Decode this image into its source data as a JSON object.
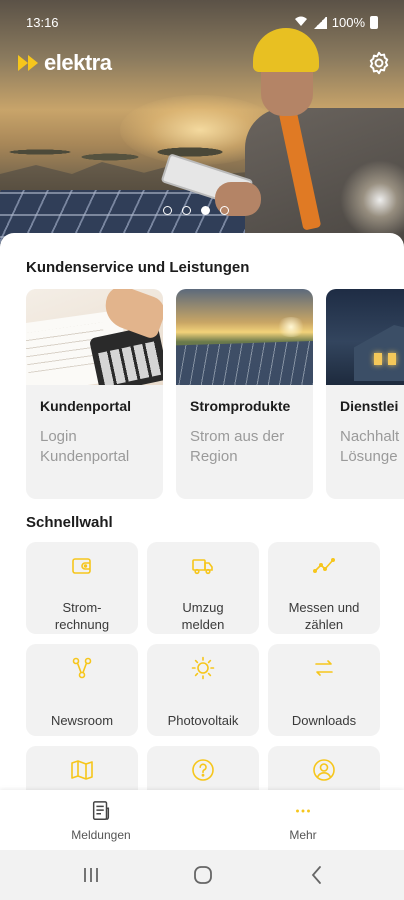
{
  "status_bar": {
    "time": "13:16",
    "battery": "100%"
  },
  "brand": {
    "name": "elektra",
    "accent": "#F6C61C"
  },
  "hero": {
    "carousel_dots": 4,
    "active_dot": 3
  },
  "services": {
    "title": "Kundenservice und Leistungen",
    "cards": [
      {
        "title": "Kundenportal",
        "subtitle": "Login Kundenportal"
      },
      {
        "title": "Stromprodukte",
        "subtitle": "Strom aus der Region"
      },
      {
        "title": "Dienstlei",
        "subtitle": "Nachhalt Lösunge"
      }
    ]
  },
  "quick": {
    "title": "Schnellwahl",
    "tiles": [
      {
        "label": "Strom-\nrechnung",
        "icon": "wallet-icon"
      },
      {
        "label": "Umzug\nmelden",
        "icon": "truck-icon"
      },
      {
        "label": "Messen und\nzählen",
        "icon": "chart-line-icon"
      },
      {
        "label": "Newsroom",
        "icon": "network-icon"
      },
      {
        "label": "Photovoltaik",
        "icon": "sun-icon"
      },
      {
        "label": "Downloads",
        "icon": "swap-arrows-icon"
      },
      {
        "label": "",
        "icon": "map-icon"
      },
      {
        "label": "",
        "icon": "question-icon"
      },
      {
        "label": "",
        "icon": "user-icon"
      }
    ]
  },
  "bottom_nav": {
    "items": [
      {
        "label": "Meldungen",
        "icon": "document-icon"
      },
      {
        "label": "Mehr",
        "icon": "more-dots-icon"
      }
    ]
  }
}
